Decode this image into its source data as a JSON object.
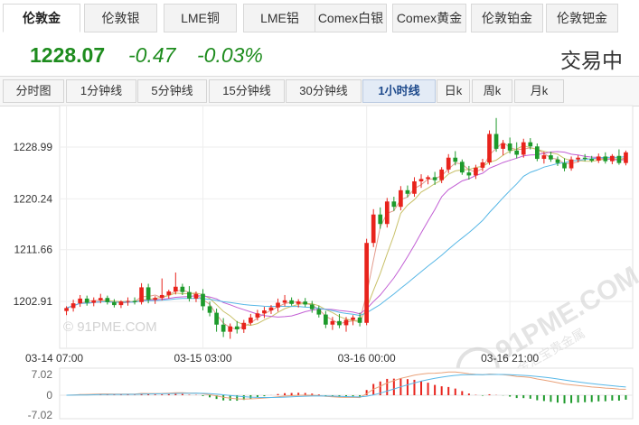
{
  "tabs": [
    {
      "label": "伦敦金",
      "active": true
    },
    {
      "label": "伦敦银"
    },
    {
      "label": "LME铜"
    },
    {
      "label": "LME铝"
    },
    {
      "label": "Comex白银"
    },
    {
      "label": "Comex黄金"
    },
    {
      "label": "伦敦铂金"
    },
    {
      "label": "伦敦钯金"
    }
  ],
  "quote": {
    "price": "1228.07",
    "change": "-0.47",
    "change_pct": "-0.03%",
    "status": "交易中",
    "color": "#1e8c1e"
  },
  "periods": [
    {
      "label": "分时图"
    },
    {
      "label": "1分钟线"
    },
    {
      "label": "5分钟线"
    },
    {
      "label": "15分钟线"
    },
    {
      "label": "30分钟线"
    },
    {
      "label": "1小时线",
      "active": true
    },
    {
      "label": "日k"
    },
    {
      "label": "周k"
    },
    {
      "label": "月k"
    }
  ],
  "watermarks": {
    "left": "© 91PME.COM",
    "right_top": "91PME.COM",
    "right_sub": "金汇宝贵金属"
  },
  "chart_data": {
    "type": "candlestick",
    "y_ticks": [
      "1228.99",
      "1220.24",
      "1211.66",
      "1202.91"
    ],
    "x_ticks": [
      "03-14 07:00",
      "03-15 03:00",
      "03-16 00:00",
      "03-16 21:00"
    ],
    "ylim": [
      1195,
      1236
    ],
    "candles": [
      [
        1201.3,
        1202.1,
        1200.6,
        1201.8
      ],
      [
        1201.8,
        1203.2,
        1201.2,
        1202.6
      ],
      [
        1202.6,
        1204.0,
        1202.0,
        1203.4
      ],
      [
        1203.4,
        1203.9,
        1202.2,
        1202.7
      ],
      [
        1202.7,
        1203.6,
        1202.1,
        1203.1
      ],
      [
        1203.1,
        1204.2,
        1202.6,
        1203.5
      ],
      [
        1203.5,
        1203.9,
        1202.4,
        1202.8
      ],
      [
        1202.8,
        1203.3,
        1201.9,
        1202.3
      ],
      [
        1202.3,
        1203.1,
        1201.8,
        1202.9
      ],
      [
        1202.9,
        1203.6,
        1202.2,
        1203.0
      ],
      [
        1203.0,
        1203.6,
        1202.4,
        1202.8
      ],
      [
        1202.8,
        1206.0,
        1202.4,
        1205.3
      ],
      [
        1205.3,
        1205.9,
        1202.6,
        1203.2
      ],
      [
        1203.2,
        1203.8,
        1202.5,
        1203.5
      ],
      [
        1203.5,
        1206.8,
        1203.1,
        1204.0
      ],
      [
        1204.0,
        1204.9,
        1203.4,
        1204.6
      ],
      [
        1204.6,
        1207.8,
        1204.1,
        1205.4
      ],
      [
        1205.4,
        1205.9,
        1204.0,
        1204.5
      ],
      [
        1204.5,
        1205.5,
        1202.9,
        1203.4
      ],
      [
        1203.4,
        1204.6,
        1202.8,
        1204.2
      ],
      [
        1204.2,
        1205.0,
        1201.4,
        1202.1
      ],
      [
        1202.1,
        1202.9,
        1200.4,
        1201.0
      ],
      [
        1201.0,
        1201.7,
        1197.8,
        1199.0
      ],
      [
        1199.0,
        1200.1,
        1196.9,
        1197.8
      ],
      [
        1197.8,
        1199.2,
        1196.6,
        1198.7
      ],
      [
        1198.7,
        1199.6,
        1197.5,
        1198.2
      ],
      [
        1198.2,
        1199.8,
        1197.6,
        1199.3
      ],
      [
        1199.3,
        1200.8,
        1198.9,
        1200.2
      ],
      [
        1200.2,
        1201.5,
        1199.7,
        1200.9
      ],
      [
        1200.9,
        1202.0,
        1200.1,
        1201.4
      ],
      [
        1201.4,
        1202.3,
        1200.8,
        1201.9
      ],
      [
        1201.9,
        1203.4,
        1201.2,
        1202.7
      ],
      [
        1202.7,
        1204.0,
        1202.1,
        1203.1
      ],
      [
        1203.1,
        1203.6,
        1202.2,
        1202.5
      ],
      [
        1202.5,
        1203.3,
        1201.9,
        1202.9
      ],
      [
        1202.9,
        1203.5,
        1202.0,
        1202.4
      ],
      [
        1202.4,
        1203.0,
        1201.0,
        1201.6
      ],
      [
        1201.6,
        1202.2,
        1200.2,
        1200.7
      ],
      [
        1200.7,
        1201.3,
        1198.4,
        1199.0
      ],
      [
        1199.0,
        1200.3,
        1198.1,
        1199.6
      ],
      [
        1199.6,
        1200.8,
        1198.4,
        1198.9
      ],
      [
        1198.9,
        1200.3,
        1197.8,
        1199.8
      ],
      [
        1199.8,
        1200.6,
        1198.9,
        1200.2
      ],
      [
        1200.2,
        1201.0,
        1198.7,
        1199.3
      ],
      [
        1199.3,
        1213.5,
        1198.9,
        1212.8
      ],
      [
        1212.8,
        1218.5,
        1212.1,
        1217.6
      ],
      [
        1217.6,
        1218.8,
        1215.2,
        1216.0
      ],
      [
        1216.0,
        1220.4,
        1215.4,
        1219.8
      ],
      [
        1219.8,
        1220.6,
        1218.2,
        1218.9
      ],
      [
        1218.9,
        1222.4,
        1218.3,
        1221.7
      ],
      [
        1221.7,
        1222.5,
        1220.5,
        1221.1
      ],
      [
        1221.1,
        1223.9,
        1220.6,
        1223.2
      ],
      [
        1223.2,
        1224.4,
        1222.1,
        1223.6
      ],
      [
        1223.6,
        1224.2,
        1222.7,
        1223.9
      ],
      [
        1223.9,
        1224.8,
        1222.6,
        1223.4
      ],
      [
        1223.4,
        1225.6,
        1222.9,
        1225.2
      ],
      [
        1225.2,
        1227.8,
        1224.6,
        1227.2
      ],
      [
        1227.2,
        1228.3,
        1225.9,
        1226.5
      ],
      [
        1226.5,
        1226.9,
        1224.3,
        1224.7
      ],
      [
        1224.7,
        1225.8,
        1223.5,
        1224.2
      ],
      [
        1224.2,
        1226.0,
        1223.6,
        1225.5
      ],
      [
        1225.5,
        1227.0,
        1224.9,
        1226.4
      ],
      [
        1226.4,
        1231.8,
        1226.0,
        1231.2
      ],
      [
        1231.2,
        1233.9,
        1228.2,
        1228.7
      ],
      [
        1228.7,
        1230.2,
        1227.6,
        1229.6
      ],
      [
        1229.6,
        1230.6,
        1227.9,
        1228.4
      ],
      [
        1228.4,
        1229.8,
        1227.1,
        1227.7
      ],
      [
        1227.7,
        1230.4,
        1227.2,
        1229.8
      ],
      [
        1229.8,
        1230.5,
        1228.6,
        1229.1
      ],
      [
        1229.1,
        1229.6,
        1226.6,
        1227.0
      ],
      [
        1227.0,
        1228.2,
        1226.2,
        1227.6
      ],
      [
        1227.6,
        1228.2,
        1226.5,
        1226.9
      ],
      [
        1226.9,
        1227.4,
        1225.8,
        1226.3
      ],
      [
        1226.3,
        1227.1,
        1224.9,
        1225.4
      ],
      [
        1225.4,
        1227.4,
        1225.0,
        1226.9
      ],
      [
        1226.9,
        1227.6,
        1226.4,
        1227.2
      ],
      [
        1227.2,
        1227.8,
        1226.6,
        1227.0
      ],
      [
        1227.0,
        1227.5,
        1226.4,
        1226.7
      ],
      [
        1226.7,
        1227.9,
        1226.3,
        1227.4
      ],
      [
        1227.4,
        1228.1,
        1226.2,
        1226.6
      ],
      [
        1226.6,
        1227.8,
        1226.1,
        1227.5
      ],
      [
        1227.5,
        1228.6,
        1226.0,
        1226.3
      ],
      [
        1226.3,
        1228.4,
        1225.9,
        1228.1
      ]
    ],
    "up_color": "#e8231c",
    "down_color": "#1d9a2b",
    "ma_colors": [
      "#e39b8c",
      "#c9c16a",
      "#c25fd4",
      "#57b7e6"
    ],
    "macd": {
      "label_top": "7.02",
      "label_mid": "0",
      "label_bottom": "-7.02",
      "range": 7.02
    }
  }
}
